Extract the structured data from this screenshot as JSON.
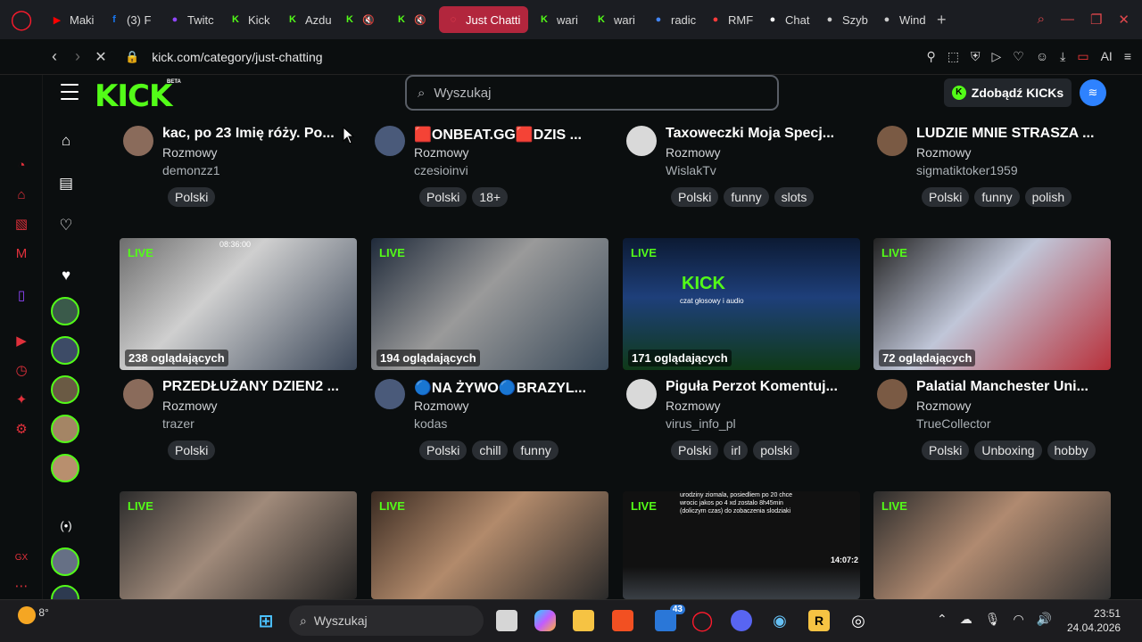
{
  "browser": {
    "tabs": [
      {
        "label": "Maki",
        "icon": "youtube-icon",
        "color": "#ff0000"
      },
      {
        "label": "(3) F",
        "icon": "facebook-icon",
        "color": "#1877f2"
      },
      {
        "label": "Twitc",
        "icon": "twitch-icon",
        "color": "#9146ff"
      },
      {
        "label": "Kick",
        "icon": "kick-icon",
        "color": "#53fc18"
      },
      {
        "label": "Azdu",
        "icon": "kick-icon",
        "color": "#53fc18"
      },
      {
        "label": "",
        "icon": "kick-muted-icon",
        "color": "#53fc18"
      },
      {
        "label": "",
        "icon": "kick-muted-icon",
        "color": "#53fc18"
      },
      {
        "label": "Just Chatti",
        "icon": "loading-icon",
        "color": "#ff4d5a",
        "active": true
      },
      {
        "label": "wari",
        "icon": "kick-icon",
        "color": "#53fc18"
      },
      {
        "label": "wari",
        "icon": "kick-icon",
        "color": "#53fc18"
      },
      {
        "label": "radic",
        "icon": "google-icon",
        "color": "#4285f4"
      },
      {
        "label": "RMF",
        "icon": "radio-icon",
        "color": "#ff3b3b"
      },
      {
        "label": "Chat",
        "icon": "chatgpt-icon",
        "color": "#ffffff"
      },
      {
        "label": "Szyb",
        "icon": "grid-icon",
        "color": "#cccccc"
      },
      {
        "label": "Wind",
        "icon": "settings-icon",
        "color": "#cccccc"
      }
    ],
    "url": "kick.com/category/just-chatting",
    "ai_label": "AI"
  },
  "kick": {
    "logo": "KICK",
    "beta": "BETA",
    "search_placeholder": "Wyszukaj",
    "get_kicks_label": "Zdobądź KICKs",
    "accent": "#53fc18"
  },
  "streams_top": [
    {
      "title": "kac, po 23 Imię róży. Po...",
      "category": "Rozmowy",
      "user": "demonzz1",
      "tags": [
        "Polski"
      ]
    },
    {
      "title": "🟥ONBEAT.GG🟥DZIS ...",
      "category": "Rozmowy",
      "user": "czesioinvi",
      "tags": [
        "Polski",
        "18+"
      ]
    },
    {
      "title": "Taxoweczki Moja Specj...",
      "category": "Rozmowy",
      "user": "WislakTv",
      "tags": [
        "Polski",
        "funny",
        "slots"
      ]
    },
    {
      "title": "LUDZIE MNIE STRASZA ...",
      "category": "Rozmowy",
      "user": "sigmatiktoker1959",
      "tags": [
        "Polski",
        "funny",
        "polish"
      ]
    }
  ],
  "streams_mid": [
    {
      "live": "LIVE",
      "viewers": "238 oglądających",
      "title": "PRZEDŁUŻANY DZIEN2 ...",
      "category": "Rozmowy",
      "user": "trazer",
      "tags": [
        "Polski"
      ],
      "overlay": "08:36:00"
    },
    {
      "live": "LIVE",
      "viewers": "194 oglądających",
      "title": "🔵NA ŻYWO🔵BRAZYL...",
      "category": "Rozmowy",
      "user": "kodas",
      "tags": [
        "Polski",
        "chill",
        "funny"
      ]
    },
    {
      "live": "LIVE",
      "viewers": "171 oglądających",
      "title": "Piguła Perzot Komentuj...",
      "category": "Rozmowy",
      "user": "virus_info_pl",
      "tags": [
        "Polski",
        "irl",
        "polski"
      ],
      "overlay": "KICK",
      "overlay_sub": "czat głosowy i audio"
    },
    {
      "live": "LIVE",
      "viewers": "72 oglądających",
      "title": "Palatial Manchester Uni...",
      "category": "Rozmowy",
      "user": "TrueCollector",
      "tags": [
        "Polski",
        "Unboxing",
        "hobby"
      ]
    }
  ],
  "streams_bottom": [
    {
      "live": "LIVE"
    },
    {
      "live": "LIVE"
    },
    {
      "live": "LIVE",
      "overlay": "urodziny ziomala, posiedliem po 20 chce wrocic jakos po 4 xd zostalo 8h45min (doliczym czas) do zobaczenia slodziaki",
      "time": "14:07:2"
    },
    {
      "live": "LIVE"
    }
  ],
  "taskbar": {
    "weather": "8°",
    "search_placeholder": "Wyszukaj",
    "badge_count": "43",
    "time": "23:51",
    "date": "24.04.2026"
  }
}
